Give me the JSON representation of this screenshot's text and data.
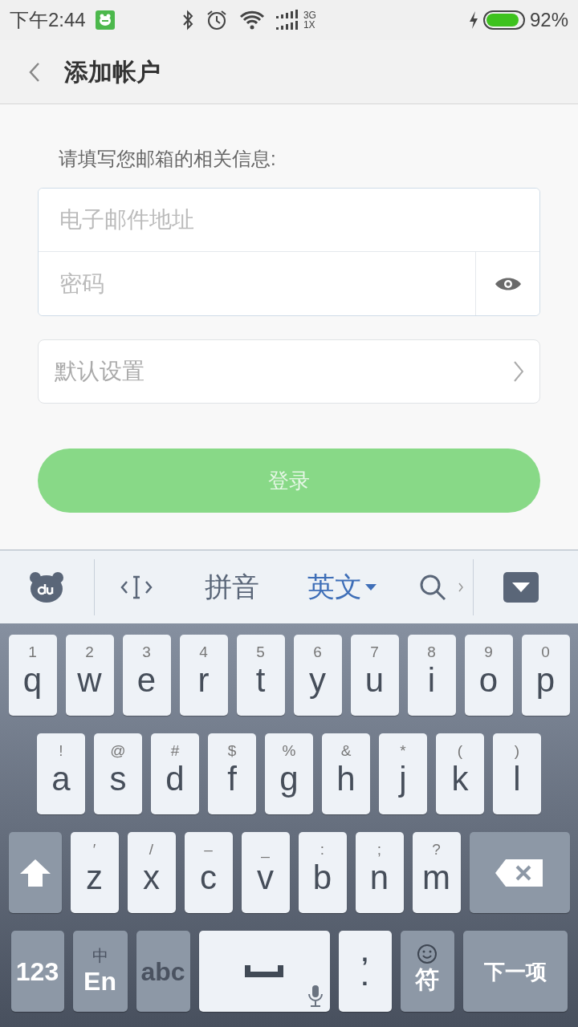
{
  "status_bar": {
    "time": "下午2:44",
    "network": "3G\n1X",
    "battery_percent": "92%"
  },
  "header": {
    "title": "添加帐户"
  },
  "form": {
    "prompt": "请填写您邮箱的相关信息:",
    "email": {
      "placeholder": "电子邮件地址"
    },
    "password": {
      "placeholder": "密码"
    },
    "settings_row": {
      "label": "默认设置"
    },
    "login_button": {
      "label": "登录",
      "disabled": true
    }
  },
  "keyboard_toolbar": {
    "modes": [
      {
        "label": "拼音",
        "selected": false
      },
      {
        "label": "英文",
        "selected": true
      }
    ]
  },
  "keyboard": {
    "row_1": [
      {
        "kind": "letter",
        "main": "q",
        "sub": "1"
      },
      {
        "kind": "letter",
        "main": "w",
        "sub": "2"
      },
      {
        "kind": "letter",
        "main": "e",
        "sub": "3"
      },
      {
        "kind": "letter",
        "main": "r",
        "sub": "4"
      },
      {
        "kind": "letter",
        "main": "t",
        "sub": "5"
      },
      {
        "kind": "letter",
        "main": "y",
        "sub": "6"
      },
      {
        "kind": "letter",
        "main": "u",
        "sub": "7"
      },
      {
        "kind": "letter",
        "main": "i",
        "sub": "8"
      },
      {
        "kind": "letter",
        "main": "o",
        "sub": "9"
      },
      {
        "kind": "letter",
        "main": "p",
        "sub": "0"
      }
    ],
    "row_2": [
      {
        "kind": "letter",
        "main": "a",
        "sub": "!"
      },
      {
        "kind": "letter",
        "main": "s",
        "sub": "@"
      },
      {
        "kind": "letter",
        "main": "d",
        "sub": "#"
      },
      {
        "kind": "letter",
        "main": "f",
        "sub": "$"
      },
      {
        "kind": "letter",
        "main": "g",
        "sub": "%"
      },
      {
        "kind": "letter",
        "main": "h",
        "sub": "&"
      },
      {
        "kind": "letter",
        "main": "j",
        "sub": "*"
      },
      {
        "kind": "letter",
        "main": "k",
        "sub": "("
      },
      {
        "kind": "letter",
        "main": "l",
        "sub": ")"
      }
    ],
    "row_3": [
      {
        "kind": "shift"
      },
      {
        "kind": "letter",
        "main": "z",
        "sub": "′"
      },
      {
        "kind": "letter",
        "main": "x",
        "sub": "/"
      },
      {
        "kind": "letter",
        "main": "c",
        "sub": "–"
      },
      {
        "kind": "letter",
        "main": "v",
        "sub": "_"
      },
      {
        "kind": "letter",
        "main": "b",
        "sub": ":"
      },
      {
        "kind": "letter",
        "main": "n",
        "sub": ";"
      },
      {
        "kind": "letter",
        "main": "m",
        "sub": "?"
      },
      {
        "kind": "backspace"
      }
    ],
    "bottom_row": [
      {
        "kind": "function",
        "main": "123",
        "selected": false
      },
      {
        "kind": "function",
        "sub": "中",
        "main": "En",
        "selected": false
      },
      {
        "kind": "function",
        "main": "abc",
        "selected": true
      },
      {
        "kind": "space"
      },
      {
        "kind": "punct",
        "sub": ",",
        "main": "."
      },
      {
        "kind": "emoji",
        "main": "符"
      },
      {
        "kind": "function",
        "main": "下一项",
        "selected": false
      }
    ]
  }
}
